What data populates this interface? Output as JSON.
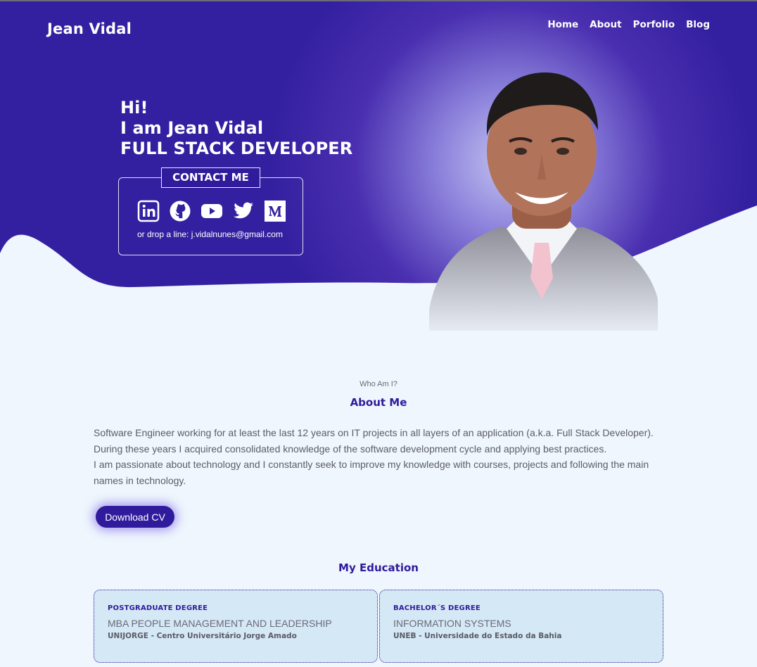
{
  "header": {
    "brand": "Jean Vidal",
    "nav": [
      "Home",
      "About",
      "Porfolio",
      "Blog"
    ]
  },
  "hero": {
    "greeting": "Hi!",
    "name_line": "I am Jean Vidal",
    "role_line": "FULL STACK DEVELOPER",
    "contact_title": "CONTACT ME",
    "socials": [
      "linkedin-icon",
      "github-icon",
      "youtube-icon",
      "twitter-icon",
      "medium-icon"
    ],
    "drop_line": "or drop a line: j.vidalnunes@gmail.com"
  },
  "about": {
    "kicker": "Who Am I?",
    "title": "About Me",
    "paragraphs": [
      "Software Engineer working for at least the last 12 years on IT projects in all layers of an application (a.k.a. Full Stack Developer).",
      "During these years I acquired consolidated knowledge of the software development cycle and applying best practices.",
      "I am passionate about technology and I constantly seek to improve my knowledge with courses, projects and following the main names in technology."
    ],
    "download_label": "Download CV"
  },
  "education": {
    "title": "My Education",
    "items": [
      {
        "level": "POSTGRADUATE DEGREE",
        "course": "MBA PEOPLE MANAGEMENT AND LEADERSHIP",
        "institution": "UNIJORGE - Centro Universitário Jorge Amado"
      },
      {
        "level": "BACHELOR´S DEGREE",
        "course": "INFORMATION SYSTEMS",
        "institution": "UNEB - Universidade do Estado da Bahia"
      }
    ]
  },
  "colors": {
    "primary": "#2f1b9c",
    "page_bg": "#eff6fd",
    "card_bg": "#d5e8f5"
  }
}
